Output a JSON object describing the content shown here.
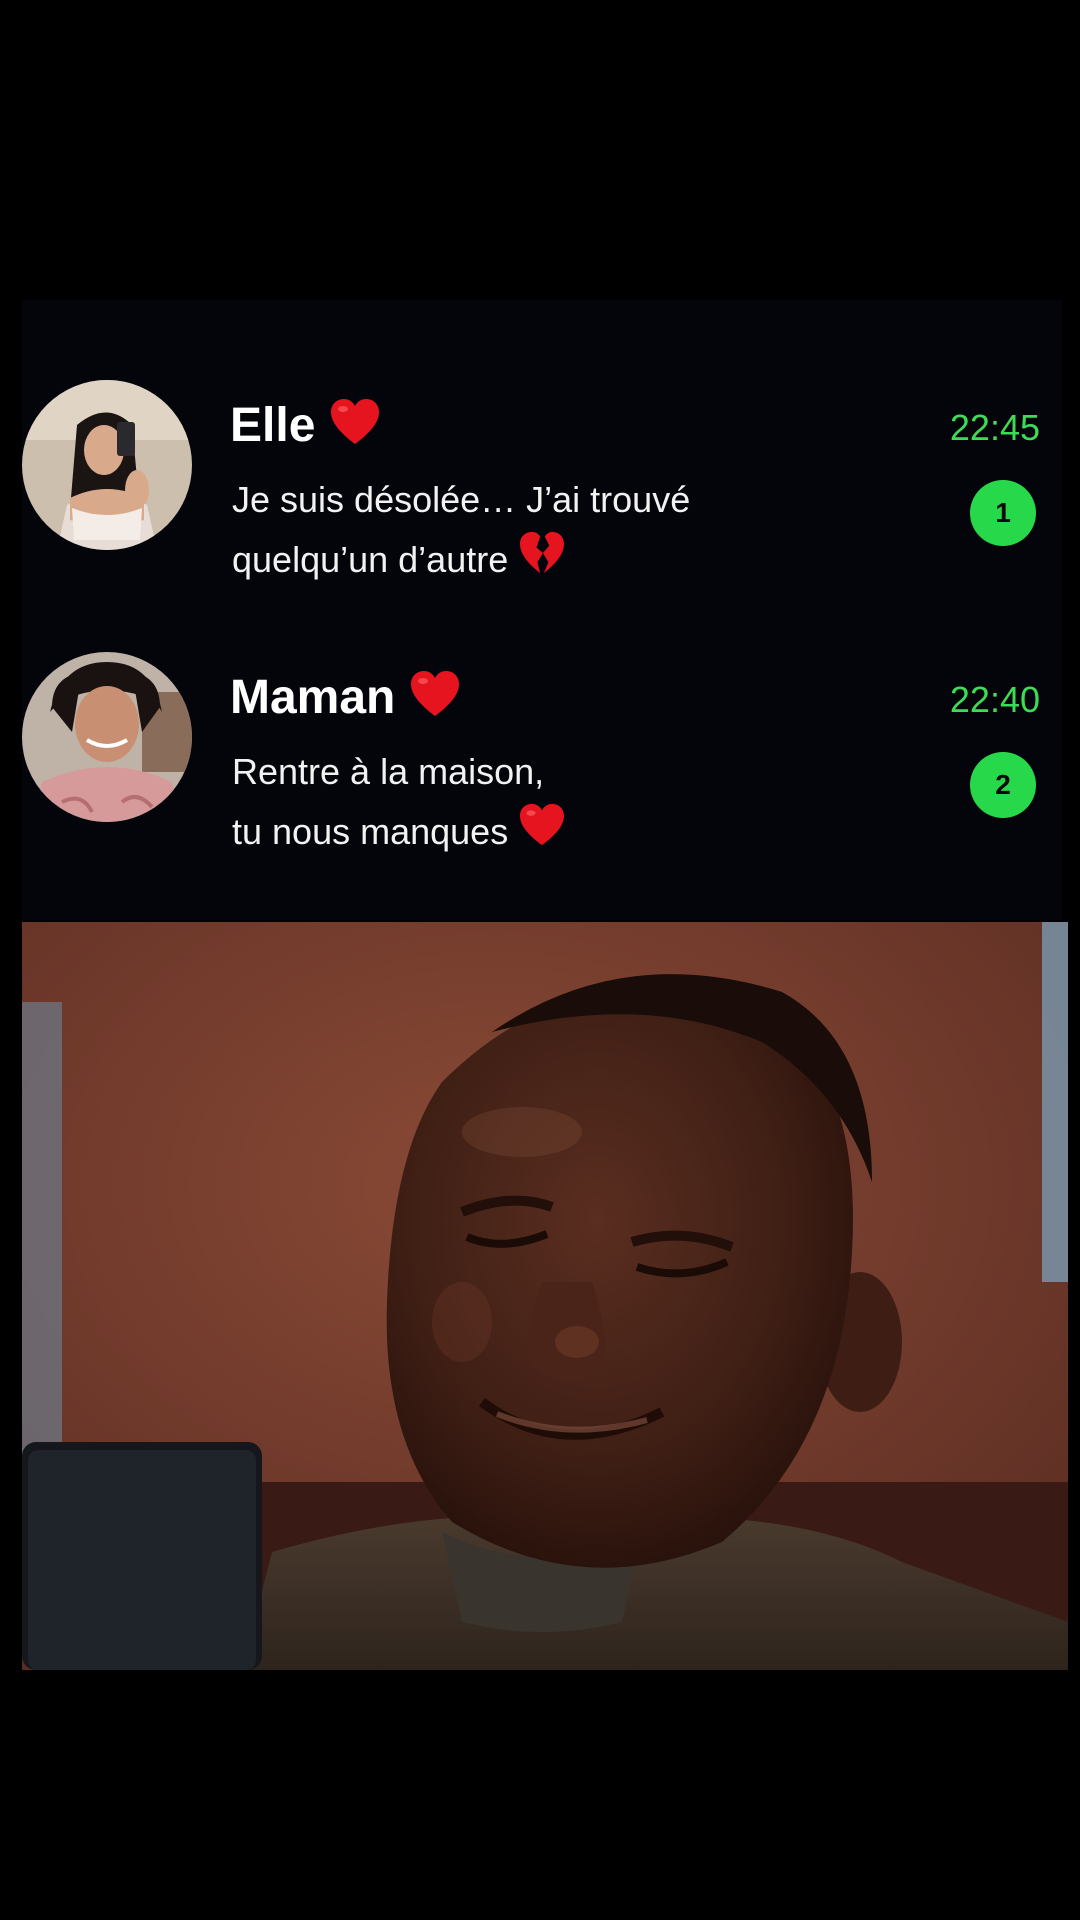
{
  "colors": {
    "background": "#000000",
    "time_accent": "#3ddc56",
    "badge": "#27d84a",
    "heart": "#e5141e"
  },
  "chats": [
    {
      "name": "Elle",
      "name_icon": "red-heart-icon",
      "message_line1": "Je suis désolée… J’ai trouvé",
      "message_line2": "quelqu’un d’autre",
      "message_icon": "broken-heart-icon",
      "time": "22:45",
      "unread": "1"
    },
    {
      "name": "Maman",
      "name_icon": "red-heart-icon",
      "message_line1": "Rentre à la maison,",
      "message_line2": "tu nous manques",
      "message_icon": "red-heart-icon",
      "time": "22:40",
      "unread": "2"
    }
  ],
  "photo": {
    "subject": "man-smiling-at-phone"
  }
}
